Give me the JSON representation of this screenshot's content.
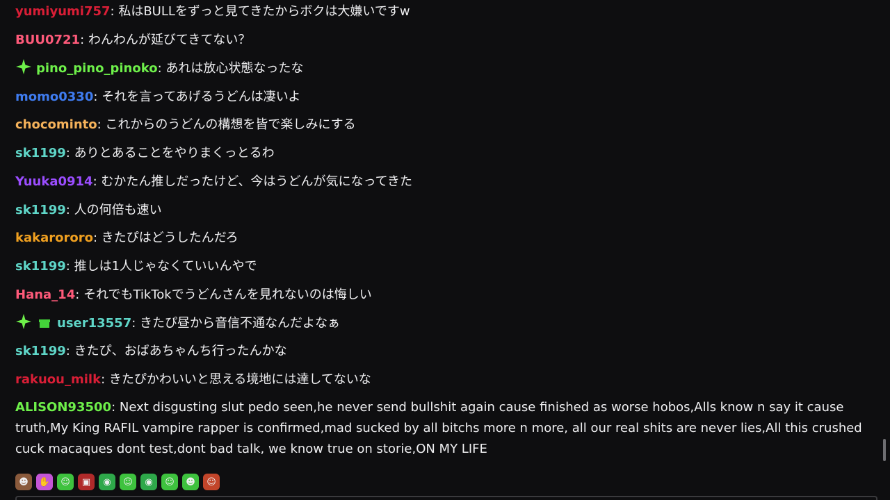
{
  "messages": [
    {
      "user": "yumiyumi757",
      "color": "#d91e36",
      "text": "私はBULLをずっと見てきたからボクは大嫌いですw"
    },
    {
      "user": "BUU0721",
      "color": "#ff5a7a",
      "text": "わんわんが延びてきてない？"
    },
    {
      "user": "pino_pino_pinoko",
      "color": "#6ef04a",
      "text": "あれは放心状態なったな",
      "badges": [
        "sparkle-badge"
      ]
    },
    {
      "user": "momo0330",
      "color": "#3f7cf0",
      "text": "それを言ってあげるうどんは凄いよ"
    },
    {
      "user": "chocominto",
      "color": "#f5b25a",
      "text": "これからのうどんの構想を皆で楽しみにする"
    },
    {
      "user": "sk1199",
      "color": "#5fd6c8",
      "text": "ありとあることをやりまくっとるわ"
    },
    {
      "user": "Yuuka0914",
      "color": "#9b4dff",
      "text": "むかたん推しだったけど、今はうどんが気になってきた"
    },
    {
      "user": "sk1199",
      "color": "#5fd6c8",
      "text": "人の何倍も速い"
    },
    {
      "user": "kakarororo",
      "color": "#f0a020",
      "text": "きたぴはどうしたんだろ"
    },
    {
      "user": "sk1199",
      "color": "#5fd6c8",
      "text": "推しは1人じゃなくていいんやで"
    },
    {
      "user": "Hana_14",
      "color": "#ff5a7a",
      "text": "それでもTikTokでうどんさんを見れないのは悔しい"
    },
    {
      "user": "user13557",
      "color": "#5fd6c8",
      "text": "きたぴ昼から音信不通なんだよなぁ",
      "badges": [
        "sparkle-badge",
        "gift-badge"
      ]
    },
    {
      "user": "sk1199",
      "color": "#5fd6c8",
      "text": "きたぴ、おばあちゃんち行ったんかな"
    },
    {
      "user": "rakuou_milk",
      "color": "#d91e36",
      "text": "きたぴかわいいと思える境地には達してないな"
    },
    {
      "user": "ALISON93500",
      "color": "#6ef04a",
      "text": "Next disgusting slut pedo seen,he never send bullshit again cause finished as worse hobos,Alls know n say it cause truth,My King RAFIL vampire rapper is confirmed,mad sucked by all bitchs more n more, all our real shits are never lies,All this crushed cuck macaques dont test,dont bad talk, we know true on storie,ON MY LIFE"
    }
  ],
  "emotes": [
    {
      "name": "face-photo-emote",
      "bg": "#8a5a3c",
      "glyph": "☻"
    },
    {
      "name": "pink-hand-emote",
      "bg": "#c455d6",
      "glyph": "✋"
    },
    {
      "name": "green-angel-emote",
      "bg": "#3ec23e",
      "glyph": "☺"
    },
    {
      "name": "red-robot-emote",
      "bg": "#b02a2a",
      "glyph": "▣"
    },
    {
      "name": "green-panda-emote",
      "bg": "#2ea84a",
      "glyph": "◉"
    },
    {
      "name": "green-grin-emote",
      "bg": "#3ec23e",
      "glyph": "☺"
    },
    {
      "name": "green-panda-emote-2",
      "bg": "#2ea84a",
      "glyph": "◉"
    },
    {
      "name": "green-smile-emote",
      "bg": "#3ec23e",
      "glyph": "☺"
    },
    {
      "name": "green-blob-emote",
      "bg": "#3ec23e",
      "glyph": "☻"
    },
    {
      "name": "red-cap-emote",
      "bg": "#c2452a",
      "glyph": "☺"
    }
  ]
}
